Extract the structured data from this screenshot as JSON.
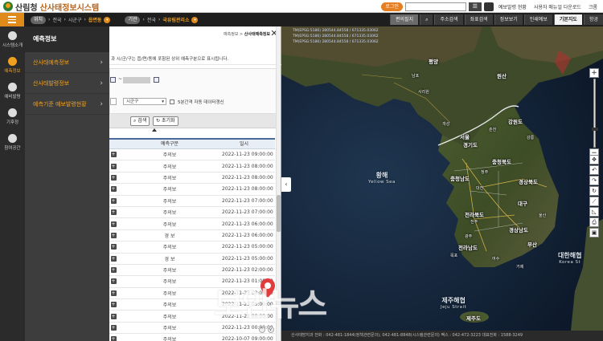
{
  "header": {
    "logo_org": "산림청",
    "logo_system": "산사태정보시스템",
    "login_label": "로그인",
    "search_placeholder": "",
    "links": [
      "예보발령 현황",
      "사용자 매뉴얼 다운로드",
      "크롬"
    ]
  },
  "navbar": {
    "loc_badge": "위치",
    "loc_path": [
      "전국",
      "시군구"
    ],
    "loc_selected": "읍면동",
    "org_badge": "기관",
    "org_path": [
      "전국"
    ],
    "org_selected": "국유림관리소",
    "buttons": [
      "편의필지",
      "주소검색",
      "좌표검색",
      "정보보기",
      "인쇄예보",
      "기본지도",
      "항공"
    ]
  },
  "sidebar": {
    "items": [
      {
        "label": "시스템소개",
        "icon": "info-icon"
      },
      {
        "label": "예측정보",
        "icon": "alert-icon",
        "active": true
      },
      {
        "label": "예비발령",
        "icon": "speaker-icon"
      },
      {
        "label": "기후정",
        "icon": "document-icon"
      },
      {
        "label": "참여공간",
        "icon": "chat-icon"
      }
    ]
  },
  "submenu": {
    "title": "예측정보",
    "items": [
      "산사태예측정보",
      "산사태발령정보",
      "예측기준 예보발령현황"
    ]
  },
  "panel": {
    "breadcrumb_prefix": "예측정보 >",
    "breadcrumb_current": "산사태예측정보",
    "close_label": "✕",
    "description": "과 시/군/구는 읍/면/동에 포함된 상위 예측구분으로 표시됩니다.",
    "date_sep": "~",
    "district_select": "시군구",
    "checkbox_label": "5분간격 자동 데이터갱신",
    "search_button": "검색",
    "reset_button": "초기화",
    "table": {
      "headers": [
        "예측구분",
        "일시"
      ],
      "rows": [
        {
          "level": "주의보",
          "time": "2022-11-23 09:00:00"
        },
        {
          "level": "주의보",
          "time": "2022-11-23 08:00:00"
        },
        {
          "level": "주의보",
          "time": "2022-11-23 08:00:00"
        },
        {
          "level": "주의보",
          "time": "2022-11-23 08:00:00"
        },
        {
          "level": "주의보",
          "time": "2022-11-23 07:00:00"
        },
        {
          "level": "주의보",
          "time": "2022-11-23 07:00:00"
        },
        {
          "level": "주의보",
          "time": "2022-11-23 06:00:00"
        },
        {
          "level": "경  보",
          "time": "2022-11-23 06:00:00"
        },
        {
          "level": "주의보",
          "time": "2022-11-23 05:00:00"
        },
        {
          "level": "경  보",
          "time": "2022-11-23 05:00:00"
        },
        {
          "level": "주의보",
          "time": "2022-11-23 02:00:00"
        },
        {
          "level": "주의보",
          "time": "2022-11-23 01:00:00"
        },
        {
          "level": "주의보",
          "time": "2022-11-23 00:00:00"
        },
        {
          "level": "주의보",
          "time": "2022-11-23 00:00:00"
        },
        {
          "level": "주의보",
          "time": "2022-11-23 00:00:00"
        },
        {
          "level": "주의보",
          "time": "2022-11-23 00:00:00"
        },
        {
          "level": "주의보",
          "time": "2022-10-07 09:00:00"
        }
      ]
    }
  },
  "map": {
    "coords": [
      "TM(EPSG:5186) 280544.84558 / 671335.03062",
      "TM(EPSG:5186) 280544.84558 / 671335.03062",
      "TM(EPSG:5186) 280544.84558 / 671335.03062"
    ],
    "sea_labels": [
      {
        "ko": "황해",
        "en": "Yellow Sea"
      },
      {
        "ko": "대한해협",
        "en": "Korea St"
      },
      {
        "ko": "제주해협",
        "en": "Jeju Strait"
      }
    ],
    "place_labels": [
      "평양",
      "원산",
      "강원도",
      "서울",
      "경기도",
      "충청북도",
      "충청남도",
      "경상북도",
      "전라북도",
      "대구",
      "경상남도",
      "전라남도",
      "부산",
      "제주도"
    ],
    "small_labels": [
      "남포",
      "사리원",
      "개성",
      "춘천",
      "강릉",
      "청주",
      "대전",
      "전주",
      "광주",
      "울산",
      "목포",
      "여수",
      "거제"
    ],
    "status_text": "산사태방지과 전화 : 042-481-1844(정책관련문의), 042-481-8848(시스템관련문의) 팩스 : 042-472-3223 대표전화 : 1588-3249"
  },
  "watermark": "보안뉴스",
  "colors": {
    "accent": "#e08a1c",
    "submenu_text": "#f0a020",
    "nav_bg": "#1e1e1e"
  }
}
